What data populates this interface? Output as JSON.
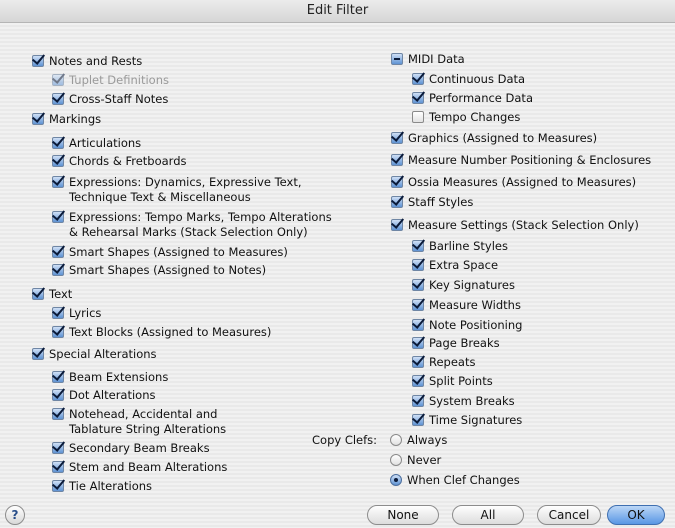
{
  "window": {
    "title": "Edit Filter"
  },
  "left_items": [
    {
      "label": "Notes and Rests",
      "state": "checked"
    },
    {
      "label": "Tuplet Definitions",
      "state": "checked",
      "dim": true
    },
    {
      "label": "Cross-Staff Notes",
      "state": "checked"
    },
    {
      "label": "Markings",
      "state": "checked"
    },
    {
      "label": "Articulations",
      "state": "checked"
    },
    {
      "label": "Chords & Fretboards",
      "state": "checked"
    },
    {
      "label": "Expressions: Dynamics, Expressive Text,",
      "line2": "Technique Text & Miscellaneous",
      "state": "checked"
    },
    {
      "label": "Expressions: Tempo Marks, Tempo Alterations",
      "line2": "& Rehearsal Marks (Stack Selection Only)",
      "state": "checked"
    },
    {
      "label": "Smart Shapes (Assigned to Measures)",
      "state": "checked"
    },
    {
      "label": "Smart Shapes (Assigned to Notes)",
      "state": "checked"
    },
    {
      "label": "Text",
      "state": "checked"
    },
    {
      "label": "Lyrics",
      "state": "checked"
    },
    {
      "label": "Text Blocks (Assigned to Measures)",
      "state": "checked"
    },
    {
      "label": "Special Alterations",
      "state": "checked"
    },
    {
      "label": "Beam Extensions",
      "state": "checked"
    },
    {
      "label": "Dot Alterations",
      "state": "checked"
    },
    {
      "label": "Notehead, Accidental and",
      "line2": "Tablature String Alterations",
      "state": "checked"
    },
    {
      "label": "Secondary Beam Breaks",
      "state": "checked"
    },
    {
      "label": "Stem and Beam Alterations",
      "state": "checked"
    },
    {
      "label": "Tie Alterations",
      "state": "checked"
    }
  ],
  "right_items": [
    {
      "label": "MIDI Data",
      "state": "mixed"
    },
    {
      "label": "Continuous Data",
      "state": "checked"
    },
    {
      "label": "Performance Data",
      "state": "checked"
    },
    {
      "label": "Tempo Changes",
      "state": "unchecked"
    },
    {
      "label": "Graphics (Assigned to Measures)",
      "state": "checked"
    },
    {
      "label": "Measure Number Positioning & Enclosures",
      "state": "checked"
    },
    {
      "label": "Ossia Measures (Assigned to Measures)",
      "state": "checked"
    },
    {
      "label": "Staff Styles",
      "state": "checked"
    },
    {
      "label": "Measure Settings (Stack Selection Only)",
      "state": "checked"
    },
    {
      "label": "Barline Styles",
      "state": "checked"
    },
    {
      "label": "Extra Space",
      "state": "checked"
    },
    {
      "label": "Key Signatures",
      "state": "checked"
    },
    {
      "label": "Measure Widths",
      "state": "checked"
    },
    {
      "label": "Note Positioning",
      "state": "checked"
    },
    {
      "label": "Page Breaks",
      "state": "checked"
    },
    {
      "label": "Repeats",
      "state": "checked"
    },
    {
      "label": "Split Points",
      "state": "checked"
    },
    {
      "label": "System Breaks",
      "state": "checked"
    },
    {
      "label": "Time Signatures",
      "state": "checked"
    }
  ],
  "copy_clefs": {
    "label": "Copy Clefs:",
    "options": [
      {
        "label": "Always",
        "selected": false
      },
      {
        "label": "Never",
        "selected": false
      },
      {
        "label": "When Clef Changes",
        "selected": true
      }
    ]
  },
  "buttons": {
    "none": "None",
    "all": "All",
    "cancel": "Cancel",
    "ok": "OK"
  },
  "help": "?"
}
